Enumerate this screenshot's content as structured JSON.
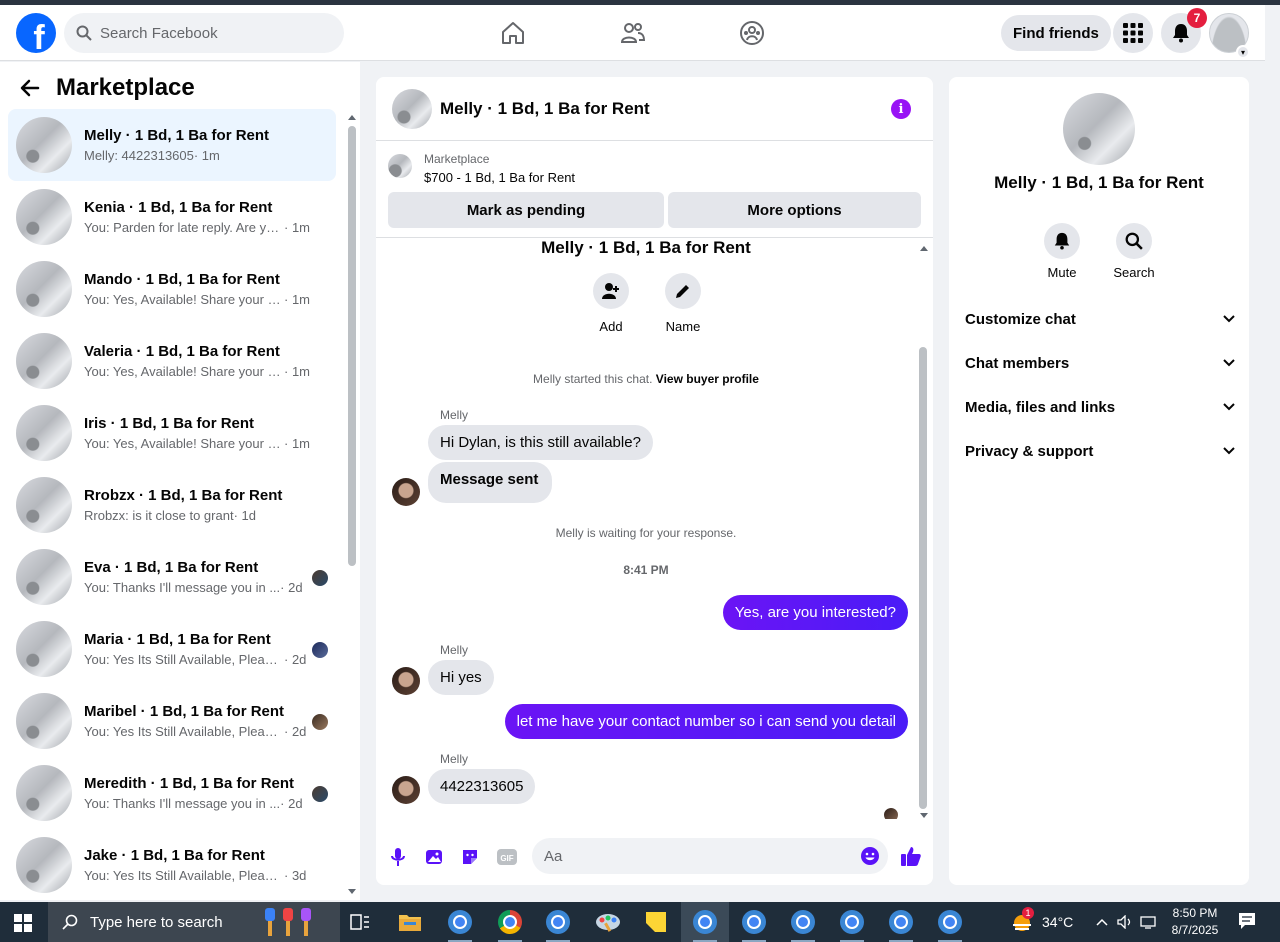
{
  "header": {
    "search_placeholder": "Search Facebook",
    "find_friends_label": "Find friends",
    "notification_count": "7"
  },
  "sidebar": {
    "title": "Marketplace",
    "conversations": [
      {
        "title": "Melly · 1 Bd, 1 Ba for Rent",
        "snippet": "Melly: 4422313605",
        "time": "· 1m",
        "active": true
      },
      {
        "title": "Kenia · 1 Bd, 1 Ba for Rent",
        "snippet": "You: Parden for late reply. Are you ...",
        "time": "· 1m"
      },
      {
        "title": "Mando · 1 Bd, 1 Ba for Rent",
        "snippet": "You: Yes, Available! Share your nu...",
        "time": "· 1m"
      },
      {
        "title": "Valeria · 1 Bd, 1 Ba for Rent",
        "snippet": "You: Yes, Available! Share your nu...",
        "time": "· 1m"
      },
      {
        "title": "Iris · 1 Bd, 1 Ba for Rent",
        "snippet": "You: Yes, Available! Share your nu...",
        "time": "· 1m"
      },
      {
        "title": "Rrobzx · 1 Bd, 1 Ba for Rent",
        "snippet": "Rrobzx: is it close to grant",
        "time": "· 1d"
      },
      {
        "title": "Eva · 1 Bd, 1 Ba for Rent",
        "snippet": "You: Thanks I'll message you in ...",
        "time": "· 2d"
      },
      {
        "title": "Maria · 1 Bd, 1 Ba for Rent",
        "snippet": "You: Yes Its Still Available, Please...",
        "time": "· 2d"
      },
      {
        "title": "Maribel · 1 Bd, 1 Ba for Rent",
        "snippet": "You: Yes Its Still Available, Please...",
        "time": "· 2d"
      },
      {
        "title": "Meredith · 1 Bd, 1 Ba for Rent",
        "snippet": "You: Thanks I'll message you in ...",
        "time": "· 2d"
      },
      {
        "title": "Jake · 1 Bd, 1 Ba for Rent",
        "snippet": "You: Yes Its Still Available, Please Se...",
        "time": "· 3d"
      }
    ]
  },
  "chat": {
    "title": "Melly · 1 Bd, 1 Ba for Rent",
    "marketplace_label": "Marketplace",
    "listing": "$700 - 1 Bd, 1 Ba for Rent",
    "mark_pending_label": "Mark as pending",
    "more_options_label": "More options",
    "intro_name": "Melly · 1 Bd, 1 Ba for Rent",
    "add_label": "Add",
    "name_label": "Name",
    "started_text": "Melly started this chat.",
    "view_profile_label": "View buyer profile",
    "sender_name": "Melly",
    "msg1": "Hi Dylan, is this still available?",
    "msg2": "Message sent",
    "waiting_text": "Melly is waiting for your response.",
    "timestamp": "8:41 PM",
    "out1": "Yes, are you interested?",
    "msg3": "Hi yes",
    "out2": "let me have your contact number so i can send you detail",
    "msg4": "4422313605",
    "composer_placeholder": "Aa"
  },
  "details": {
    "name": "Melly · 1 Bd, 1 Ba for Rent",
    "mute_label": "Mute",
    "search_label": "Search",
    "sections": [
      "Customize chat",
      "Chat members",
      "Media, files and links",
      "Privacy & support"
    ]
  },
  "taskbar": {
    "search_placeholder": "Type here to search",
    "temperature": "34°C",
    "weather_badge": "1",
    "time": "8:50 PM",
    "date": "8/7/2025"
  },
  "colors": {
    "brand_blue": "#0866ff",
    "outgoing_bubble": "#5a12f8",
    "info_purple": "#9813f5",
    "badge_red": "#e41e3f"
  }
}
